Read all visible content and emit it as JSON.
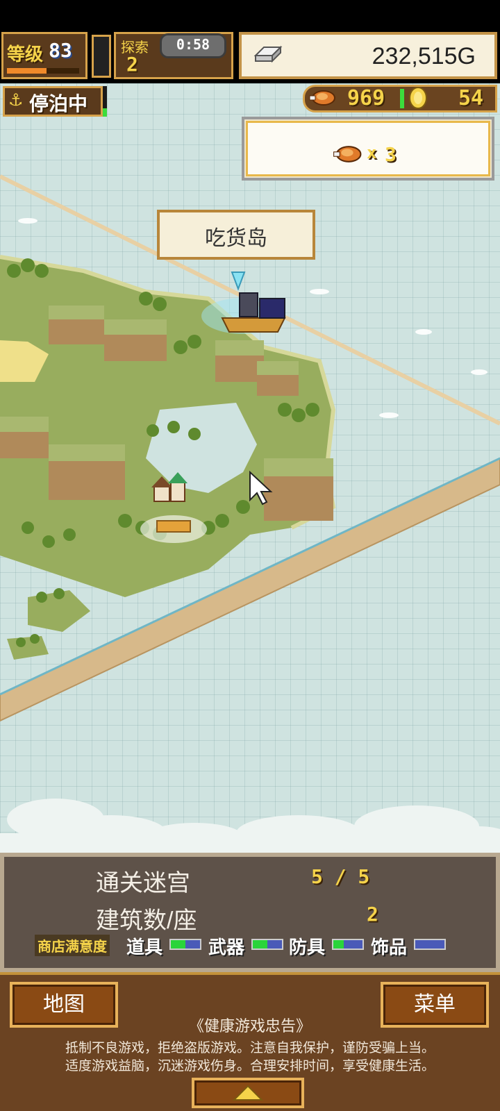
{
  "hud": {
    "level_label": "等级",
    "level_value": "83",
    "exp_fraction": 0.55,
    "voyage_label": "探索",
    "voyage_value": "2",
    "timer": "0:58",
    "money_icon": "silver-bar-icon",
    "money": "232,515G",
    "dock_icon": "anchor-icon",
    "dock_status": "停泊中",
    "food_icon": "meat-icon",
    "food": "969",
    "coin_icon": "gold-coin-icon",
    "coins": "54"
  },
  "reward": {
    "icon": "meat-icon",
    "times": "x",
    "count": "3"
  },
  "map": {
    "island_name": "吃货岛",
    "pointer_icon": "cursor-icon",
    "ship_icon": "pirate-ship-icon",
    "town_icon": "village-icon"
  },
  "info_panel": {
    "dungeon_label": "通关迷宫",
    "dungeon_value": "5 / 5",
    "buildings_label": "建筑数/座",
    "buildings_value": "2",
    "satisfaction_label": "商店满意度",
    "categories": [
      {
        "label": "道具",
        "fill": 0.5
      },
      {
        "label": "武器",
        "fill": 0.5
      },
      {
        "label": "防具",
        "fill": 0.35
      },
      {
        "label": "饰品",
        "fill": 0.0
      }
    ]
  },
  "bottom": {
    "map_button": "地图",
    "menu_button": "菜单",
    "advisory_title": "《健康游戏忠告》",
    "advisory_line1": "抵制不良游戏，拒绝盗版游戏。注意自我保护，谨防受骗上当。",
    "advisory_line2": "适度游戏益脑，沉迷游戏伤身。合理安排时间，享受健康生活。",
    "expand_icon": "up-arrow-icon"
  },
  "colors": {
    "hud_gold": "#f5d34a",
    "panel_brown": "#5a3a1c",
    "sea": "#cfe3e0"
  }
}
